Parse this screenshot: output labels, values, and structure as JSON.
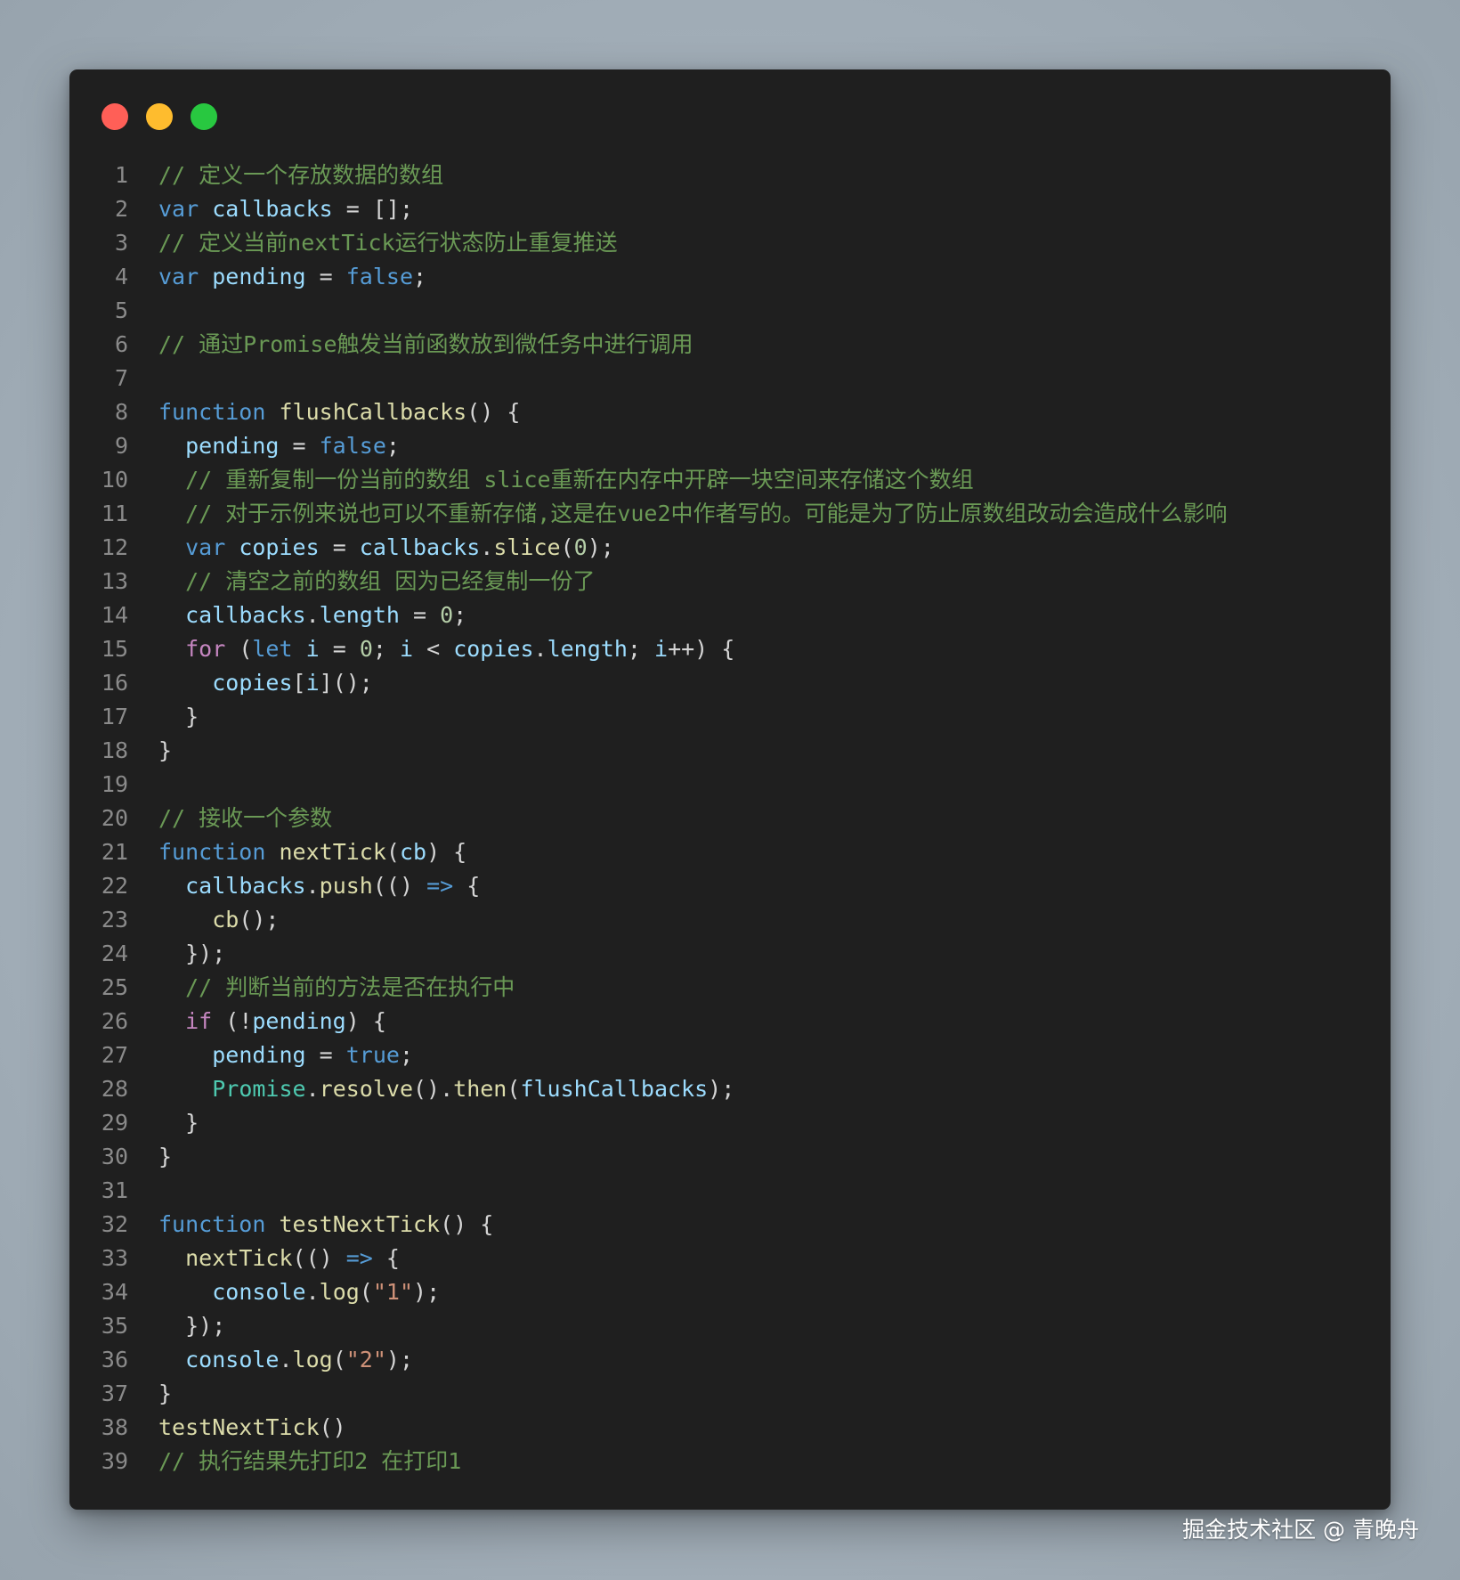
{
  "window": {
    "traffic_lights": [
      {
        "name": "close",
        "color": "#ff5f57"
      },
      {
        "name": "minimize",
        "color": "#febc2e"
      },
      {
        "name": "maximize",
        "color": "#28c840"
      }
    ]
  },
  "theme": {
    "background": "#1f1f1f",
    "comment": "#6a9955",
    "keyword": "#569cd6",
    "control": "#c586c0",
    "variable": "#9cdcfe",
    "function": "#dcdcaa",
    "number": "#b5cea8",
    "string": "#ce9178",
    "class": "#4ec9b0",
    "line_number": "#8a8a8a"
  },
  "code": {
    "lines": [
      {
        "n": "1",
        "tokens": [
          [
            "cm",
            "// 定义一个存放数据的数组"
          ]
        ]
      },
      {
        "n": "2",
        "tokens": [
          [
            "kw",
            "var"
          ],
          [
            "pn",
            " "
          ],
          [
            "vr",
            "callbacks"
          ],
          [
            "pn",
            " = [];"
          ]
        ]
      },
      {
        "n": "3",
        "tokens": [
          [
            "cm",
            "// 定义当前nextTick运行状态防止重复推送"
          ]
        ]
      },
      {
        "n": "4",
        "tokens": [
          [
            "kw",
            "var"
          ],
          [
            "pn",
            " "
          ],
          [
            "vr",
            "pending"
          ],
          [
            "pn",
            " = "
          ],
          [
            "kw",
            "false"
          ],
          [
            "pn",
            ";"
          ]
        ]
      },
      {
        "n": "5",
        "tokens": []
      },
      {
        "n": "6",
        "tokens": [
          [
            "cm",
            "// 通过Promise触发当前函数放到微任务中进行调用"
          ]
        ]
      },
      {
        "n": "7",
        "tokens": []
      },
      {
        "n": "8",
        "tokens": [
          [
            "kw",
            "function"
          ],
          [
            "pn",
            " "
          ],
          [
            "fn",
            "flushCallbacks"
          ],
          [
            "pn",
            "() {"
          ]
        ]
      },
      {
        "n": "9",
        "tokens": [
          [
            "pn",
            "  "
          ],
          [
            "vr",
            "pending"
          ],
          [
            "pn",
            " = "
          ],
          [
            "kw",
            "false"
          ],
          [
            "pn",
            ";"
          ]
        ]
      },
      {
        "n": "10",
        "tokens": [
          [
            "pn",
            "  "
          ],
          [
            "cm",
            "// 重新复制一份当前的数组 slice重新在内存中开辟一块空间来存储这个数组"
          ]
        ]
      },
      {
        "n": "11",
        "tokens": [
          [
            "pn",
            "  "
          ],
          [
            "cm",
            "// 对于示例来说也可以不重新存储,这是在vue2中作者写的。可能是为了防止原数组改动会造成什么影响"
          ]
        ]
      },
      {
        "n": "12",
        "tokens": [
          [
            "pn",
            "  "
          ],
          [
            "kw",
            "var"
          ],
          [
            "pn",
            " "
          ],
          [
            "vr",
            "copies"
          ],
          [
            "pn",
            " = "
          ],
          [
            "vr",
            "callbacks"
          ],
          [
            "pn",
            "."
          ],
          [
            "fn",
            "slice"
          ],
          [
            "pn",
            "("
          ],
          [
            "num",
            "0"
          ],
          [
            "pn",
            ");"
          ]
        ]
      },
      {
        "n": "13",
        "tokens": [
          [
            "pn",
            "  "
          ],
          [
            "cm",
            "// 清空之前的数组 因为已经复制一份了"
          ]
        ]
      },
      {
        "n": "14",
        "tokens": [
          [
            "pn",
            "  "
          ],
          [
            "vr",
            "callbacks"
          ],
          [
            "pn",
            "."
          ],
          [
            "vr",
            "length"
          ],
          [
            "pn",
            " = "
          ],
          [
            "num",
            "0"
          ],
          [
            "pn",
            ";"
          ]
        ]
      },
      {
        "n": "15",
        "tokens": [
          [
            "pn",
            "  "
          ],
          [
            "ctl",
            "for"
          ],
          [
            "pn",
            " ("
          ],
          [
            "kw",
            "let"
          ],
          [
            "pn",
            " "
          ],
          [
            "vr",
            "i"
          ],
          [
            "pn",
            " = "
          ],
          [
            "num",
            "0"
          ],
          [
            "pn",
            "; "
          ],
          [
            "vr",
            "i"
          ],
          [
            "pn",
            " < "
          ],
          [
            "vr",
            "copies"
          ],
          [
            "pn",
            "."
          ],
          [
            "vr",
            "length"
          ],
          [
            "pn",
            "; "
          ],
          [
            "vr",
            "i"
          ],
          [
            "pn",
            "++) {"
          ]
        ]
      },
      {
        "n": "16",
        "tokens": [
          [
            "pn",
            "    "
          ],
          [
            "vr",
            "copies"
          ],
          [
            "pn",
            "["
          ],
          [
            "vr",
            "i"
          ],
          [
            "pn",
            "]();"
          ]
        ]
      },
      {
        "n": "17",
        "tokens": [
          [
            "pn",
            "  }"
          ]
        ]
      },
      {
        "n": "18",
        "tokens": [
          [
            "pn",
            "}"
          ]
        ]
      },
      {
        "n": "19",
        "tokens": []
      },
      {
        "n": "20",
        "tokens": [
          [
            "cm",
            "// 接收一个参数"
          ]
        ]
      },
      {
        "n": "21",
        "tokens": [
          [
            "kw",
            "function"
          ],
          [
            "pn",
            " "
          ],
          [
            "fn",
            "nextTick"
          ],
          [
            "pn",
            "("
          ],
          [
            "vr",
            "cb"
          ],
          [
            "pn",
            ") {"
          ]
        ]
      },
      {
        "n": "22",
        "tokens": [
          [
            "pn",
            "  "
          ],
          [
            "vr",
            "callbacks"
          ],
          [
            "pn",
            "."
          ],
          [
            "fn",
            "push"
          ],
          [
            "pn",
            "(() "
          ],
          [
            "kw",
            "=>"
          ],
          [
            "pn",
            " {"
          ]
        ]
      },
      {
        "n": "23",
        "tokens": [
          [
            "pn",
            "    "
          ],
          [
            "fn",
            "cb"
          ],
          [
            "pn",
            "();"
          ]
        ]
      },
      {
        "n": "24",
        "tokens": [
          [
            "pn",
            "  });"
          ]
        ]
      },
      {
        "n": "25",
        "tokens": [
          [
            "pn",
            "  "
          ],
          [
            "cm",
            "// 判断当前的方法是否在执行中"
          ]
        ]
      },
      {
        "n": "26",
        "tokens": [
          [
            "pn",
            "  "
          ],
          [
            "ctl",
            "if"
          ],
          [
            "pn",
            " (!"
          ],
          [
            "vr",
            "pending"
          ],
          [
            "pn",
            ") {"
          ]
        ]
      },
      {
        "n": "27",
        "tokens": [
          [
            "pn",
            "    "
          ],
          [
            "vr",
            "pending"
          ],
          [
            "pn",
            " = "
          ],
          [
            "kw",
            "true"
          ],
          [
            "pn",
            ";"
          ]
        ]
      },
      {
        "n": "28",
        "tokens": [
          [
            "pn",
            "    "
          ],
          [
            "cls",
            "Promise"
          ],
          [
            "pn",
            "."
          ],
          [
            "fn",
            "resolve"
          ],
          [
            "pn",
            "()."
          ],
          [
            "fn",
            "then"
          ],
          [
            "pn",
            "("
          ],
          [
            "vr",
            "flushCallbacks"
          ],
          [
            "pn",
            ");"
          ]
        ]
      },
      {
        "n": "29",
        "tokens": [
          [
            "pn",
            "  }"
          ]
        ]
      },
      {
        "n": "30",
        "tokens": [
          [
            "pn",
            "}"
          ]
        ]
      },
      {
        "n": "31",
        "tokens": []
      },
      {
        "n": "32",
        "tokens": [
          [
            "kw",
            "function"
          ],
          [
            "pn",
            " "
          ],
          [
            "fn",
            "testNextTick"
          ],
          [
            "pn",
            "() {"
          ]
        ]
      },
      {
        "n": "33",
        "tokens": [
          [
            "pn",
            "  "
          ],
          [
            "fn",
            "nextTick"
          ],
          [
            "pn",
            "(() "
          ],
          [
            "kw",
            "=>"
          ],
          [
            "pn",
            " {"
          ]
        ]
      },
      {
        "n": "34",
        "tokens": [
          [
            "pn",
            "    "
          ],
          [
            "vr",
            "console"
          ],
          [
            "pn",
            "."
          ],
          [
            "fn",
            "log"
          ],
          [
            "pn",
            "("
          ],
          [
            "str",
            "\"1\""
          ],
          [
            "pn",
            ");"
          ]
        ]
      },
      {
        "n": "35",
        "tokens": [
          [
            "pn",
            "  });"
          ]
        ]
      },
      {
        "n": "36",
        "tokens": [
          [
            "pn",
            "  "
          ],
          [
            "vr",
            "console"
          ],
          [
            "pn",
            "."
          ],
          [
            "fn",
            "log"
          ],
          [
            "pn",
            "("
          ],
          [
            "str",
            "\"2\""
          ],
          [
            "pn",
            ");"
          ]
        ]
      },
      {
        "n": "37",
        "tokens": [
          [
            "pn",
            "}"
          ]
        ]
      },
      {
        "n": "38",
        "tokens": [
          [
            "fn",
            "testNextTick"
          ],
          [
            "pn",
            "()"
          ]
        ]
      },
      {
        "n": "39",
        "tokens": [
          [
            "cm",
            "// 执行结果先打印2 在打印1"
          ]
        ]
      }
    ]
  },
  "watermark": {
    "text": "掘金技术社区 @ 青晚舟"
  }
}
